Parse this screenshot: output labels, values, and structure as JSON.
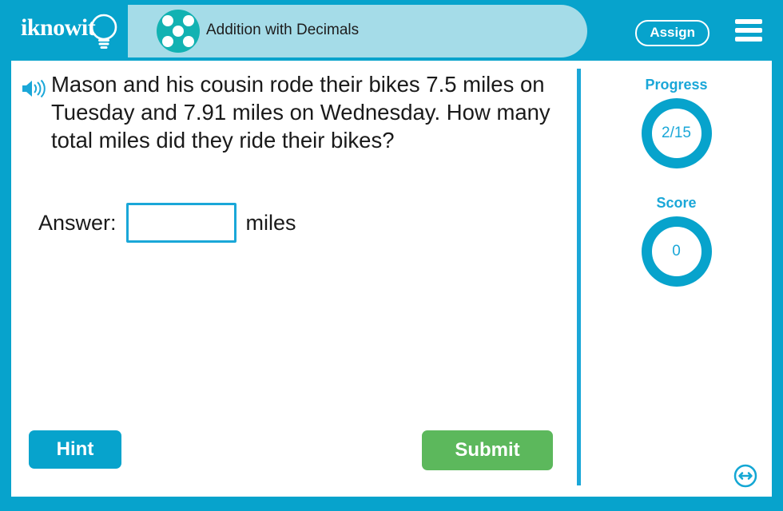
{
  "brand": {
    "logo_text": "iknowit",
    "logo_icon": "lightbulb-icon",
    "header_color": "#07a3cc",
    "title_band_color": "#a5dce8",
    "accent_color": "#1aa7d8",
    "submit_color": "#5cb85c"
  },
  "header": {
    "category_icon": "dice-five-icon",
    "title": "Addition with Decimals",
    "assign_label": "Assign",
    "menu_icon": "hamburger-menu-icon"
  },
  "main": {
    "speaker_icon": "speaker-audio-icon",
    "question": "Mason and his cousin rode their bikes 7.5 miles on Tuesday and 7.91 miles on Wednesday. How many total miles did they ride their bikes?",
    "answer_label": "Answer:",
    "answer_value": "",
    "answer_placeholder": "",
    "answer_unit": "miles",
    "hint_label": "Hint",
    "submit_label": "Submit"
  },
  "sidebar": {
    "progress": {
      "label": "Progress",
      "value": "2/15",
      "current": 2,
      "total": 15
    },
    "score": {
      "label": "Score",
      "value": "0"
    }
  },
  "footer": {
    "resize_icon": "resize-horizontal-icon"
  }
}
